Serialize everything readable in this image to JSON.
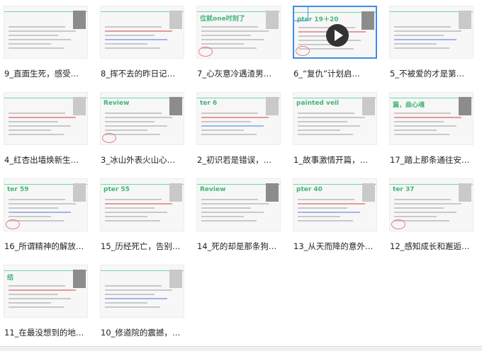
{
  "files": [
    {
      "label": "9_直面生死，感受…",
      "thumb_title": ""
    },
    {
      "label": "8_挥不去的昨日记…",
      "thumb_title": ""
    },
    {
      "label": "7_心灰意冷遇渣男…",
      "thumb_title": "位就one时刻了"
    },
    {
      "label": "6_“复仇”计划启…",
      "thumb_title": "pter 19＋20",
      "selected": true,
      "video": true
    },
    {
      "label": "5_不被爱的才是第…",
      "thumb_title": ""
    },
    {
      "label": "4_红杏出墙焕新生…",
      "thumb_title": ""
    },
    {
      "label": "3_冰山外表火山心…",
      "thumb_title": "Review"
    },
    {
      "label": "2_初识若是错误，…",
      "thumb_title": "ter 6"
    },
    {
      "label": "1_故事激情开篇，…",
      "thumb_title": "painted veil"
    },
    {
      "label": "17_踏上那条通往安…",
      "thumb_title": "篇，曲心魂"
    },
    {
      "label": "16_所谓精神的解放…",
      "thumb_title": "ter 59"
    },
    {
      "label": "15_历经死亡，告别…",
      "thumb_title": "pter 55"
    },
    {
      "label": "14_死的却是那条狗…",
      "thumb_title": "Review"
    },
    {
      "label": "13_从天而降的意外…",
      "thumb_title": "pter 40"
    },
    {
      "label": "12_感知成长和邂逅…",
      "thumb_title": "ter 37"
    },
    {
      "label": "11_在最没想到的地…",
      "thumb_title": "结"
    },
    {
      "label": "10_修道院的震撼，…",
      "thumb_title": ""
    }
  ]
}
